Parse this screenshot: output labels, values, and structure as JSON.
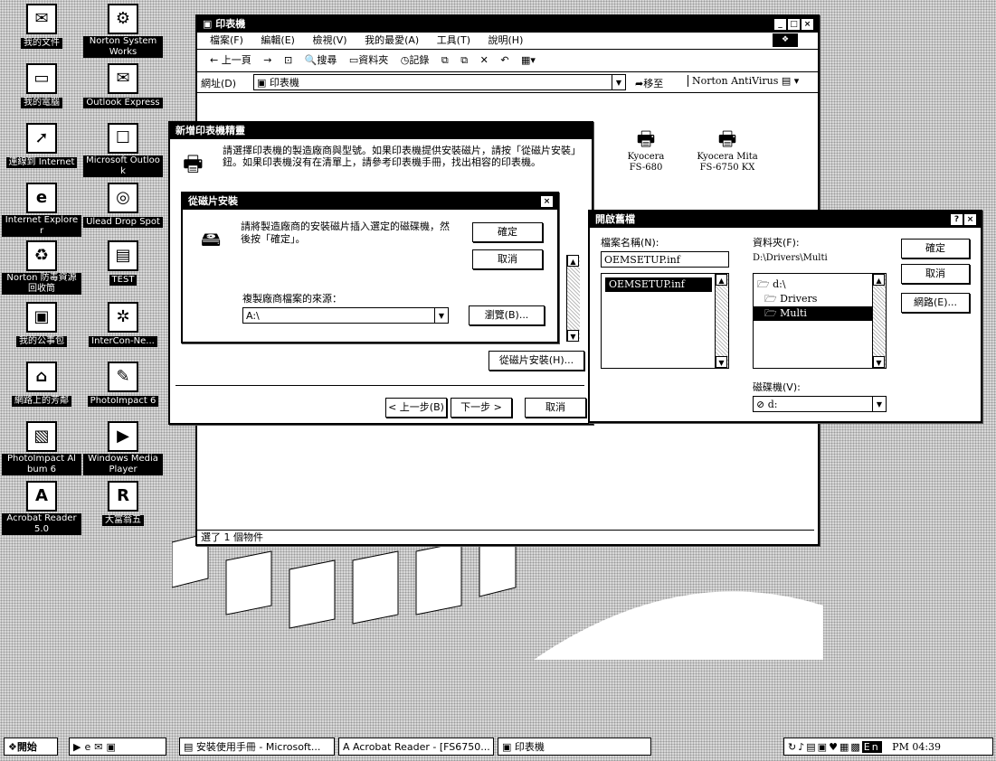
{
  "desktop_icons": [
    {
      "label": "我的文件",
      "glyph": "✉"
    },
    {
      "label": "Norton SystemWorks",
      "glyph": "⚙"
    },
    {
      "label": "我的電腦",
      "glyph": "▭"
    },
    {
      "label": "Outlook Express",
      "glyph": "✉"
    },
    {
      "label": "連線到 Internet",
      "glyph": "➚"
    },
    {
      "label": "Microsoft Outlook",
      "glyph": "☐"
    },
    {
      "label": "Internet Explorer",
      "glyph": "e"
    },
    {
      "label": "Ulead Drop Spot",
      "glyph": "◎"
    },
    {
      "label": "Norton 防毒資源回收筒",
      "glyph": "♻"
    },
    {
      "label": "TEST",
      "glyph": "▤"
    },
    {
      "label": "我的公事包",
      "glyph": "▣"
    },
    {
      "label": "InterCon-Ne...",
      "glyph": "✲"
    },
    {
      "label": "網路上的芳鄰",
      "glyph": "⌂"
    },
    {
      "label": "PhotoImpact 6",
      "glyph": "✎"
    },
    {
      "label": "PhotoImpact Album 6",
      "glyph": "▧"
    },
    {
      "label": "Windows Media Player",
      "glyph": "▶"
    },
    {
      "label": "Acrobat Reader 5.0",
      "glyph": "A"
    },
    {
      "label": "大富翁五",
      "glyph": "R"
    }
  ],
  "explorer": {
    "title": "印表機",
    "menu": [
      "檔案(F)",
      "編輯(E)",
      "檢視(V)",
      "我的最愛(A)",
      "工具(T)",
      "說明(H)"
    ],
    "toolbar": {
      "back": "← 上一頁",
      "forward": "→",
      "up": "⊡",
      "search": "搜尋",
      "folders": "資料夾",
      "history": "記錄"
    },
    "address_label": "網址(D)",
    "address_value": "印表機",
    "go_label": "移至",
    "norton_label": "Norton AntiVirus",
    "printers": [
      {
        "name": "Kyocera FS-680"
      },
      {
        "name": "Kyocera Mita FS-6750 KX"
      }
    ],
    "status": "選了 1 個物件"
  },
  "wizard": {
    "title": "新增印表機精靈",
    "text": "請選擇印表機的製造廠商與型號。如果印表機提供安裝磁片，請按「從磁片安裝」鈕。如果印表機沒有在清單上，請參考印表機手冊，找出相容的印表機。",
    "have_disk": "從磁片安裝(H)...",
    "back": "< 上一步(B)",
    "next": "下一步 >",
    "cancel": "取消"
  },
  "install_disk": {
    "title": "從磁片安裝",
    "close": "×",
    "message": "請將製造廠商的安裝磁片插入選定的磁碟機，然後按「確定」。",
    "ok": "確定",
    "cancel": "取消",
    "source_label": "複製廠商檔案的來源：",
    "source_value": "A:\\",
    "browse": "瀏覽(B)..."
  },
  "open_file": {
    "title": "開啟舊檔",
    "help": "?",
    "close": "×",
    "filename_label": "檔案名稱(N):",
    "filename_value": "OEMSETUP.inf",
    "files": [
      "OEMSETUP.inf"
    ],
    "folder_label": "資料夾(F):",
    "folder_path": "D:\\Drivers\\Multi",
    "folders": [
      "d:\\",
      "Drivers",
      "Multi"
    ],
    "ok": "確定",
    "cancel": "取消",
    "network": "網路(E)...",
    "drive_label": "磁碟機(V):",
    "drive_value": "d:"
  },
  "taskbar": {
    "start": "開始",
    "tasks": [
      "安裝使用手冊 - Microsoft...",
      "Acrobat Reader - [FS6750...",
      "印表機"
    ],
    "lang": "En",
    "clock": "PM 04:39"
  }
}
